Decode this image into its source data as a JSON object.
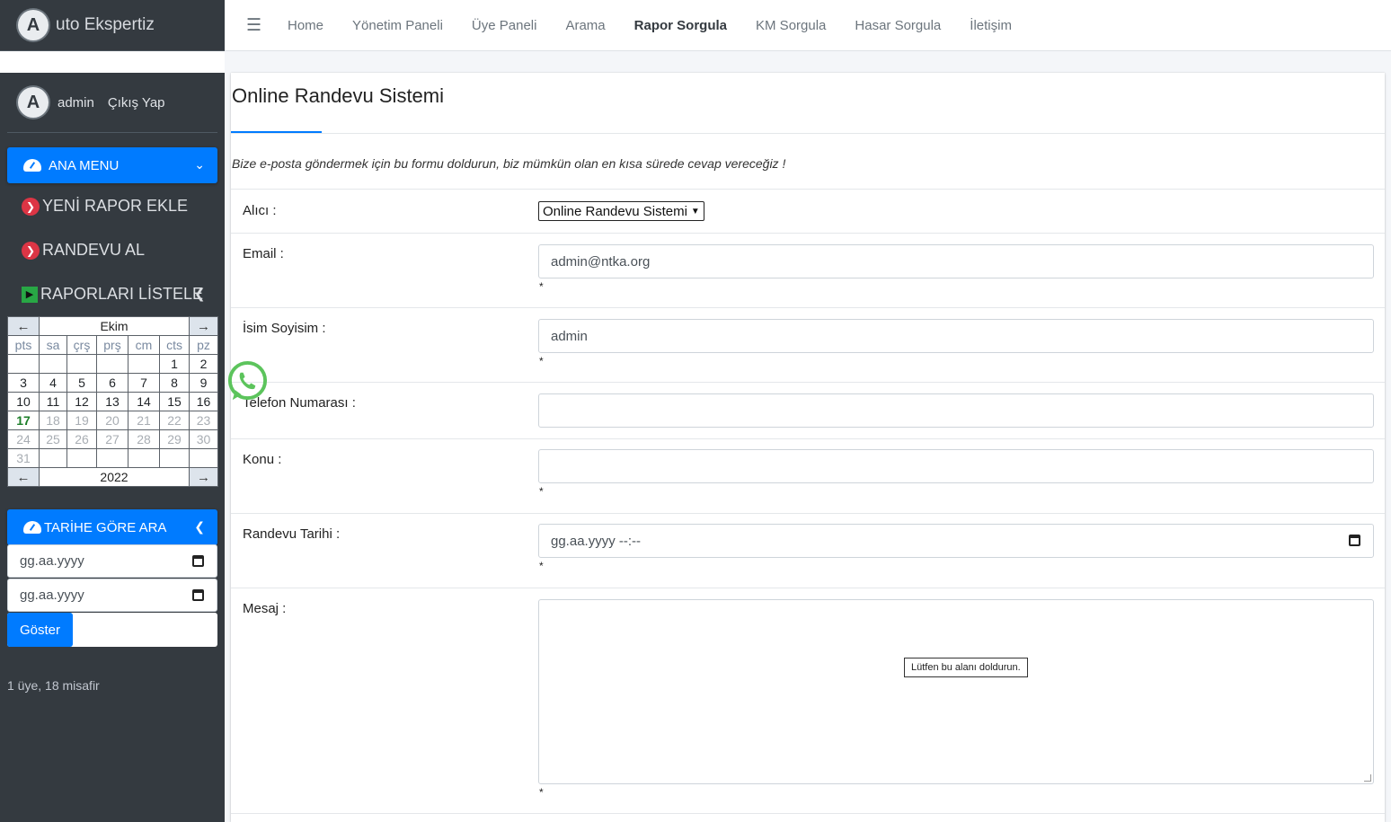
{
  "brand": {
    "logo_letter": "A",
    "text": "uto Ekspertiz"
  },
  "user": {
    "name": "admin",
    "logout": "Çıkış Yap"
  },
  "menu": {
    "main_header": "ANA MENU",
    "items": [
      "YENİ RAPOR EKLE",
      "RANDEVU AL",
      "RAPORLARI LİSTELE"
    ]
  },
  "calendar": {
    "month": "Ekim",
    "year": "2022",
    "prev": "←",
    "next": "→",
    "days_of_week": [
      "pts",
      "sa",
      "çrş",
      "prş",
      "cm",
      "cts",
      "pz"
    ],
    "weeks": [
      [
        "",
        "",
        "",
        "",
        "",
        "1",
        "2"
      ],
      [
        "3",
        "4",
        "5",
        "6",
        "7",
        "8",
        "9"
      ],
      [
        "10",
        "11",
        "12",
        "13",
        "14",
        "15",
        "16"
      ],
      [
        "17",
        "18",
        "19",
        "20",
        "21",
        "22",
        "23"
      ],
      [
        "24",
        "25",
        "26",
        "27",
        "28",
        "29",
        "30"
      ],
      [
        "31",
        "",
        "",
        "",
        "",
        "",
        ""
      ]
    ],
    "today": "17"
  },
  "date_search": {
    "header": "TARİHE GÖRE ARA",
    "start_placeholder": "gg.aa.yyyy",
    "end_placeholder": "gg.aa.yyyy",
    "button": "Göster"
  },
  "online": "1 üye, 18 misafir",
  "nav": {
    "hamburger": "☰",
    "links": [
      "Home",
      "Yönetim Paneli",
      "Üye Paneli",
      "Arama",
      "Rapor Sorgula",
      "KM Sorgula",
      "Hasar Sorgula",
      "İletişim"
    ],
    "active": "Rapor Sorgula"
  },
  "form": {
    "title": "Online Randevu Sistemi",
    "intro": "Bize e-posta göndermek için bu formu doldurun, biz mümkün olan en kısa sürede cevap vereceğiz !",
    "recipient_label": "Alıcı :",
    "recipient_value": "Online Randevu Sistemi",
    "email_label": "Email :",
    "email_value": "admin@ntka.org",
    "name_label": "İsim Soyisim :",
    "name_value": "admin",
    "phone_label": "Telefon Numarası :",
    "phone_value": "",
    "subject_label": "Konu :",
    "subject_value": "",
    "date_label": "Randevu Tarihi :",
    "date_placeholder": "gg.aa.yyyy --:--",
    "message_label": "Mesaj :",
    "required_mark": "*",
    "tooltip": "Lütfen bu alanı doldurun."
  },
  "colors": {
    "sidebar": "#343a40",
    "primary": "#007bff",
    "danger": "#dc3545",
    "success": "#28a745",
    "whatsapp": "#5cc45c"
  }
}
